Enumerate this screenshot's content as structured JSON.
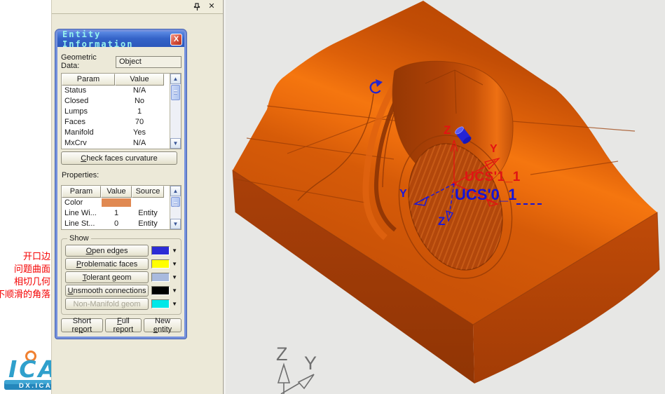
{
  "panel": {
    "pin_icon": "pin",
    "close_glyph": "✕"
  },
  "dialog": {
    "title": "Entity Information",
    "close_glyph": "X",
    "geometric_data_label": "Geometric Data:",
    "geometric_data_value": "Object",
    "params_table": {
      "headers": [
        "Param",
        "Value"
      ],
      "rows": [
        {
          "param": "Status",
          "value": "N/A"
        },
        {
          "param": "Closed",
          "value": "No"
        },
        {
          "param": "Lumps",
          "value": "1"
        },
        {
          "param": "Faces",
          "value": "70"
        },
        {
          "param": "Manifold",
          "value": "Yes"
        },
        {
          "param": "MxCrv",
          "value": "N/A"
        }
      ]
    },
    "check_button": {
      "pre": "",
      "key": "C",
      "post": "heck faces curvature"
    },
    "properties_label": "Properties:",
    "properties_table": {
      "headers": [
        "Param",
        "Value",
        "Source"
      ],
      "rows": [
        {
          "param": "Color",
          "value": "",
          "source": "",
          "swatch": "#E08952"
        },
        {
          "param": "Line Wi...",
          "value": "1",
          "source": "Entity",
          "swatch": ""
        },
        {
          "param": "Line St...",
          "value": "0",
          "source": "Entity",
          "swatch": ""
        }
      ]
    },
    "show_group": {
      "label": "Show",
      "items": [
        {
          "pre": "",
          "key": "O",
          "post": "pen edges",
          "color": "#2B2BD5"
        },
        {
          "pre": "",
          "key": "P",
          "post": "roblematic faces",
          "color": "#FFFF00"
        },
        {
          "pre": "",
          "key": "T",
          "post": "olerant geom",
          "color": "#A9BADE"
        },
        {
          "pre": "",
          "key": "U",
          "post": "nsmooth connections",
          "color": "#000000"
        },
        {
          "pre": "Non-Manifold geom",
          "key": "",
          "post": "",
          "color": "#00E8E8"
        }
      ]
    },
    "footer_buttons": [
      {
        "pre": "Short re",
        "key": "p",
        "post": "ort"
      },
      {
        "pre": "",
        "key": "F",
        "post": "ull report"
      },
      {
        "pre": "New ",
        "key": "e",
        "post": "ntity"
      }
    ]
  },
  "annotations": {
    "color": "#F40000",
    "items": [
      "开口边",
      "问题曲面",
      "相切几何",
      "不顺滑的角落"
    ]
  },
  "viewport": {
    "ucs_labels": {
      "red_z": "Z",
      "red_y": "Y",
      "blue_y": "Y",
      "blue_z": "Z",
      "red_ucs": "UCS'1_1",
      "blue_ucs": "UCS'0_1"
    },
    "axis_triad": {
      "z": "Z",
      "y": "Y"
    },
    "colors": {
      "background": "#E7E7E5",
      "model_base": "#D25608",
      "model_highlight": "#F5760F",
      "model_dark_face": "#A23C08",
      "ucs_red": "#E41212",
      "ucs_blue": "#1818DE"
    }
  },
  "logo": {
    "text": "ICAX",
    "site": "DX.ICAX.CN"
  }
}
